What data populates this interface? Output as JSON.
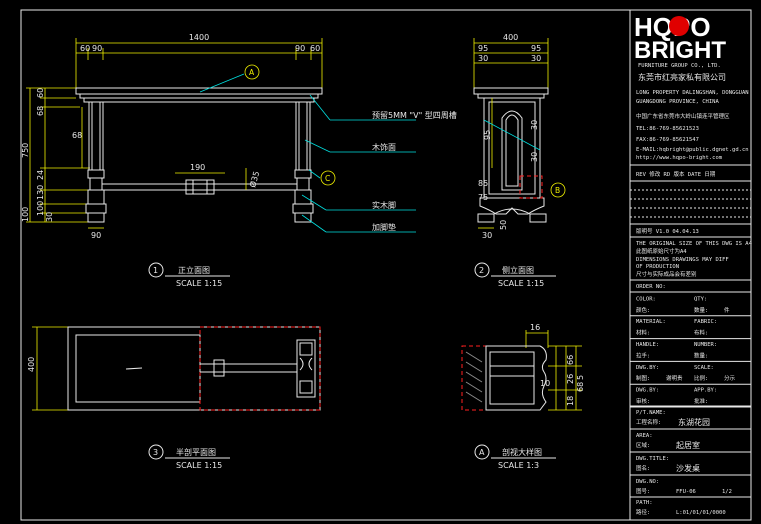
{
  "logo": {
    "top": "HQPO",
    "bottom": "BRIGHT",
    "company_en": "FURNITURE GROUP CO., LTD.",
    "company_cn": "东莞市红亮家私有限公司"
  },
  "info_lines": [
    "LONG PROPERTY DALINGSHAN, DONGGUAN",
    "GUANGDONG PROVINCE, CHINA",
    "中国广东省东莞市大岭山镇连平管理区",
    "TEL:86-769-85621523",
    "FAX:86-769-85621547",
    "E-MAIL:hqbright@public.dgnet.gd.cn",
    "http://www.hqpo-bright.com"
  ],
  "revision_row": "REV 修改  RD 版本  DATE 日期",
  "version_row": "版明号  V1.0    04.04.13",
  "notes": [
    "THE ORIGINAL SIZE OF THIS DWG IS A4",
    "此图纸原始尺寸为A4",
    "DIMENSIONS DRAWINGS MAY DIFF",
    "OF PRODUCTION",
    "尺寸与实际成品会有差别"
  ],
  "order_no": "ORDER NO:",
  "fields": [
    {
      "l1": "COLOR:",
      "v1": "",
      "l2": "QTY:",
      "v2": ""
    },
    {
      "l1": "颜色:",
      "v1": "",
      "l2": "数量:",
      "v2": "件"
    },
    {
      "l1": "MATERIAL:",
      "v1": "",
      "l2": "FABRIC:",
      "v2": ""
    },
    {
      "l1": "材料:",
      "v1": "",
      "l2": "布料:",
      "v2": ""
    },
    {
      "l1": "HANDLE:",
      "v1": "",
      "l2": "NUMBER:",
      "v2": ""
    },
    {
      "l1": "拉手:",
      "v1": "",
      "l2": "数量:",
      "v2": ""
    },
    {
      "l1": "DWG.BY:",
      "v1": "",
      "l2": "SCALE:",
      "v2": ""
    },
    {
      "l1": "制图:",
      "v1": "谢明贵",
      "l2": "比例:",
      "v2": "分示"
    },
    {
      "l1": "DWG.BY:",
      "v1": "",
      "l2": "APP.BY:",
      "v2": ""
    },
    {
      "l1": "审核:",
      "v1": "",
      "l2": "批准:",
      "v2": ""
    }
  ],
  "project_label": "P/T.NAME:",
  "project_name_label": "工程名称:",
  "project_name": "东湖花园",
  "area_label": "AREA:",
  "area_cn": "区域:",
  "area_value": "起居室",
  "dwg_title_label": "DWG.TITLE:",
  "dwg_title_cn": "图名:",
  "dwg_title": "沙发桌",
  "dwg_no_label": "DWG.NO:",
  "dwg_no_cn": "图号:",
  "dwg_no": "FFU-06",
  "dwg_page": "1/2",
  "path_label": "PATH:",
  "path_cn": "路径:",
  "path": "L:01/01/01/0000",
  "front": {
    "dims": {
      "total": "1400",
      "d60a": "60",
      "d90a": "90",
      "d90b": "90",
      "d60b": "60",
      "h750": "750",
      "h60": "60",
      "h68": "68",
      "h68b": "68",
      "h24": "24",
      "h130": "130",
      "h100": "100",
      "h30": "30",
      "h100b": "100",
      "w190": "190",
      "dia35": "Ø35",
      "w90": "90"
    },
    "callout_a": "A",
    "callout_c": "C",
    "notes": [
      "预留5MM \"V\" 型四周槽",
      "木饰面",
      "实木脚",
      "加脚垫"
    ],
    "title_num": "1",
    "title": "正立面图",
    "scale": "SCALE 1:15"
  },
  "side": {
    "dims": {
      "total": "400",
      "d95a": "95",
      "d95b": "95",
      "d30a": "30",
      "d30b": "30",
      "h95": "95",
      "h30": "30",
      "h30b": "30",
      "h85": "85",
      "h75": "75",
      "w30": "30",
      "w50": "50"
    },
    "callout_b": "B",
    "title_num": "2",
    "title": "侧立面图",
    "scale": "SCALE 1:15"
  },
  "plan": {
    "dim_depth": "400",
    "title_num": "3",
    "title": "半剖平面图",
    "scale": "SCALE 1:15"
  },
  "detail": {
    "dims": {
      "d16": "16",
      "d10": "10",
      "d66": "66",
      "d26": "26",
      "d5": "5",
      "d68": "68",
      "d18": "18"
    },
    "title_num": "A",
    "title": "剖视大样图",
    "scale": "SCALE 1:3"
  },
  "colors": {
    "line": "#e8e8e8",
    "dim": "#f0f000",
    "leader": "#00e0e0",
    "section": "#ff2020",
    "logo_o": "#e00000"
  }
}
